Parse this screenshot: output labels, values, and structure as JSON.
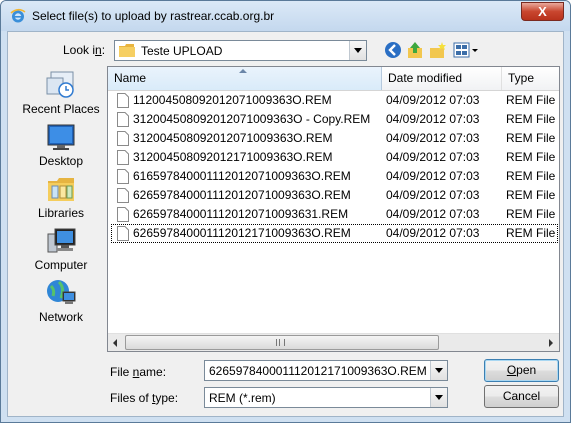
{
  "window": {
    "title": "Select file(s) to upload by rastrear.ccab.org.br",
    "close_label": "X"
  },
  "lookin": {
    "label": "Look in:",
    "value": "Teste UPLOAD"
  },
  "places": [
    {
      "label": "Recent Places",
      "icon": "recent-places-icon"
    },
    {
      "label": "Desktop",
      "icon": "desktop-icon"
    },
    {
      "label": "Libraries",
      "icon": "libraries-icon"
    },
    {
      "label": "Computer",
      "icon": "computer-icon"
    },
    {
      "label": "Network",
      "icon": "network-icon"
    }
  ],
  "columns": {
    "name": "Name",
    "date": "Date modified",
    "type": "Type"
  },
  "files": [
    {
      "name": "112004508092012071009363O.REM",
      "date": "04/09/2012 07:03",
      "type": "REM File"
    },
    {
      "name": "312004508092012071009363O - Copy.REM",
      "date": "04/09/2012 07:03",
      "type": "REM File"
    },
    {
      "name": "312004508092012071009363O.REM",
      "date": "04/09/2012 07:03",
      "type": "REM File"
    },
    {
      "name": "312004508092012171009363O.REM",
      "date": "04/09/2012 07:03",
      "type": "REM File"
    },
    {
      "name": "616597840001112012071009363O.REM",
      "date": "04/09/2012 07:03",
      "type": "REM File"
    },
    {
      "name": "626597840001112012071009363O.REM",
      "date": "04/09/2012 07:03",
      "type": "REM File"
    },
    {
      "name": "6265978400011120120710093631.REM",
      "date": "04/09/2012 07:03",
      "type": "REM File"
    },
    {
      "name": "626597840001112012171009363O.REM",
      "date": "04/09/2012 07:03",
      "type": "REM File"
    }
  ],
  "filename": {
    "label_pre": "File ",
    "label_ul": "n",
    "label_post": "ame:",
    "value": "626597840001112012171009363O.REM"
  },
  "filetype": {
    "label_pre": "Files of ",
    "label_ul": "t",
    "label_post": "ype:",
    "value": "REM  (*.rem)"
  },
  "buttons": {
    "open_ul": "O",
    "open_rest": "pen",
    "cancel": "Cancel"
  }
}
